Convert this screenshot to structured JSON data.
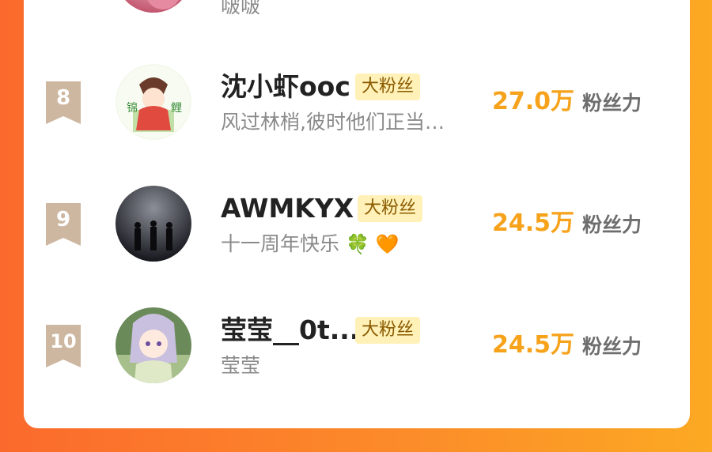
{
  "prev_row": {
    "subtitle": "啵啵"
  },
  "rows": [
    {
      "rank": "8",
      "name": "沈小虾ooc",
      "tag": "大粉丝",
      "subtitle": "风过林梢,彼时他们正当…",
      "score": "27.0万",
      "score_label": "粉丝力"
    },
    {
      "rank": "9",
      "name": "AWMKYX",
      "tag": "大粉丝",
      "subtitle": "十一周年快乐",
      "subtitle_emoji": "🍀 🧡",
      "score": "24.5万",
      "score_label": "粉丝力"
    },
    {
      "rank": "10",
      "name": "莹莹__0t...",
      "tag": "大粉丝",
      "subtitle": "莹莹",
      "score": "24.5万",
      "score_label": "粉丝力"
    }
  ],
  "colors": {
    "score": "#f6a21a",
    "tag_bg": "#fff1b8",
    "badge": "#cdb7a1",
    "background_left": "#fb6a2c",
    "background_right": "#fca923"
  },
  "icons": {
    "rank_badge": "ribbon-badge",
    "emoji": [
      "four-leaf-clover",
      "orange-heart"
    ]
  }
}
